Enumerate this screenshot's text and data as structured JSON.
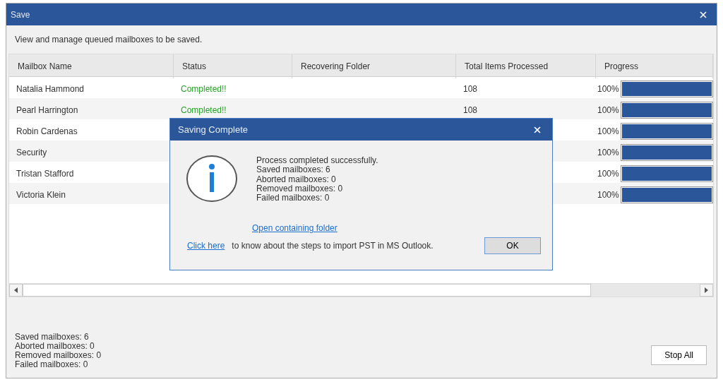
{
  "window": {
    "title": "Save",
    "description": "View and manage queued mailboxes to be saved."
  },
  "table": {
    "columns": [
      "Mailbox Name",
      "Status",
      "Recovering Folder",
      "Total Items Processed",
      "Progress"
    ],
    "rows": [
      {
        "name": "Natalia Hammond",
        "status": "Completed!!",
        "items": "108",
        "percent": "100%",
        "level": 1
      },
      {
        "name": "Pearl Harrington",
        "status": "Completed!!",
        "items": "108",
        "percent": "100%",
        "level": 1
      },
      {
        "name": "Robin Cardenas",
        "percent": "100%",
        "level": 1
      },
      {
        "name": "Security",
        "percent": "100%",
        "level": 1
      },
      {
        "name": "Tristan Stafford",
        "percent": "100%",
        "level": 1
      },
      {
        "name": "Victoria Klein",
        "percent": "100%",
        "level": 1
      }
    ]
  },
  "summary": [
    "Saved mailboxes: 6",
    "Aborted mailboxes: 0",
    "Removed mailboxes: 0",
    "Failed mailboxes: 0"
  ],
  "stop_button": "Stop All",
  "dialog": {
    "title": "Saving Complete",
    "lines": [
      "Process completed successfully.",
      "Saved mailboxes: 6",
      "Aborted mailboxes: 0",
      "Removed mailboxes: 0",
      "Failed mailboxes: 0"
    ],
    "folder_link": "Open containing folder",
    "help_link": "Click here",
    "help_text": "to know about the steps to import PST in MS Outlook.",
    "ok_button": "OK"
  }
}
